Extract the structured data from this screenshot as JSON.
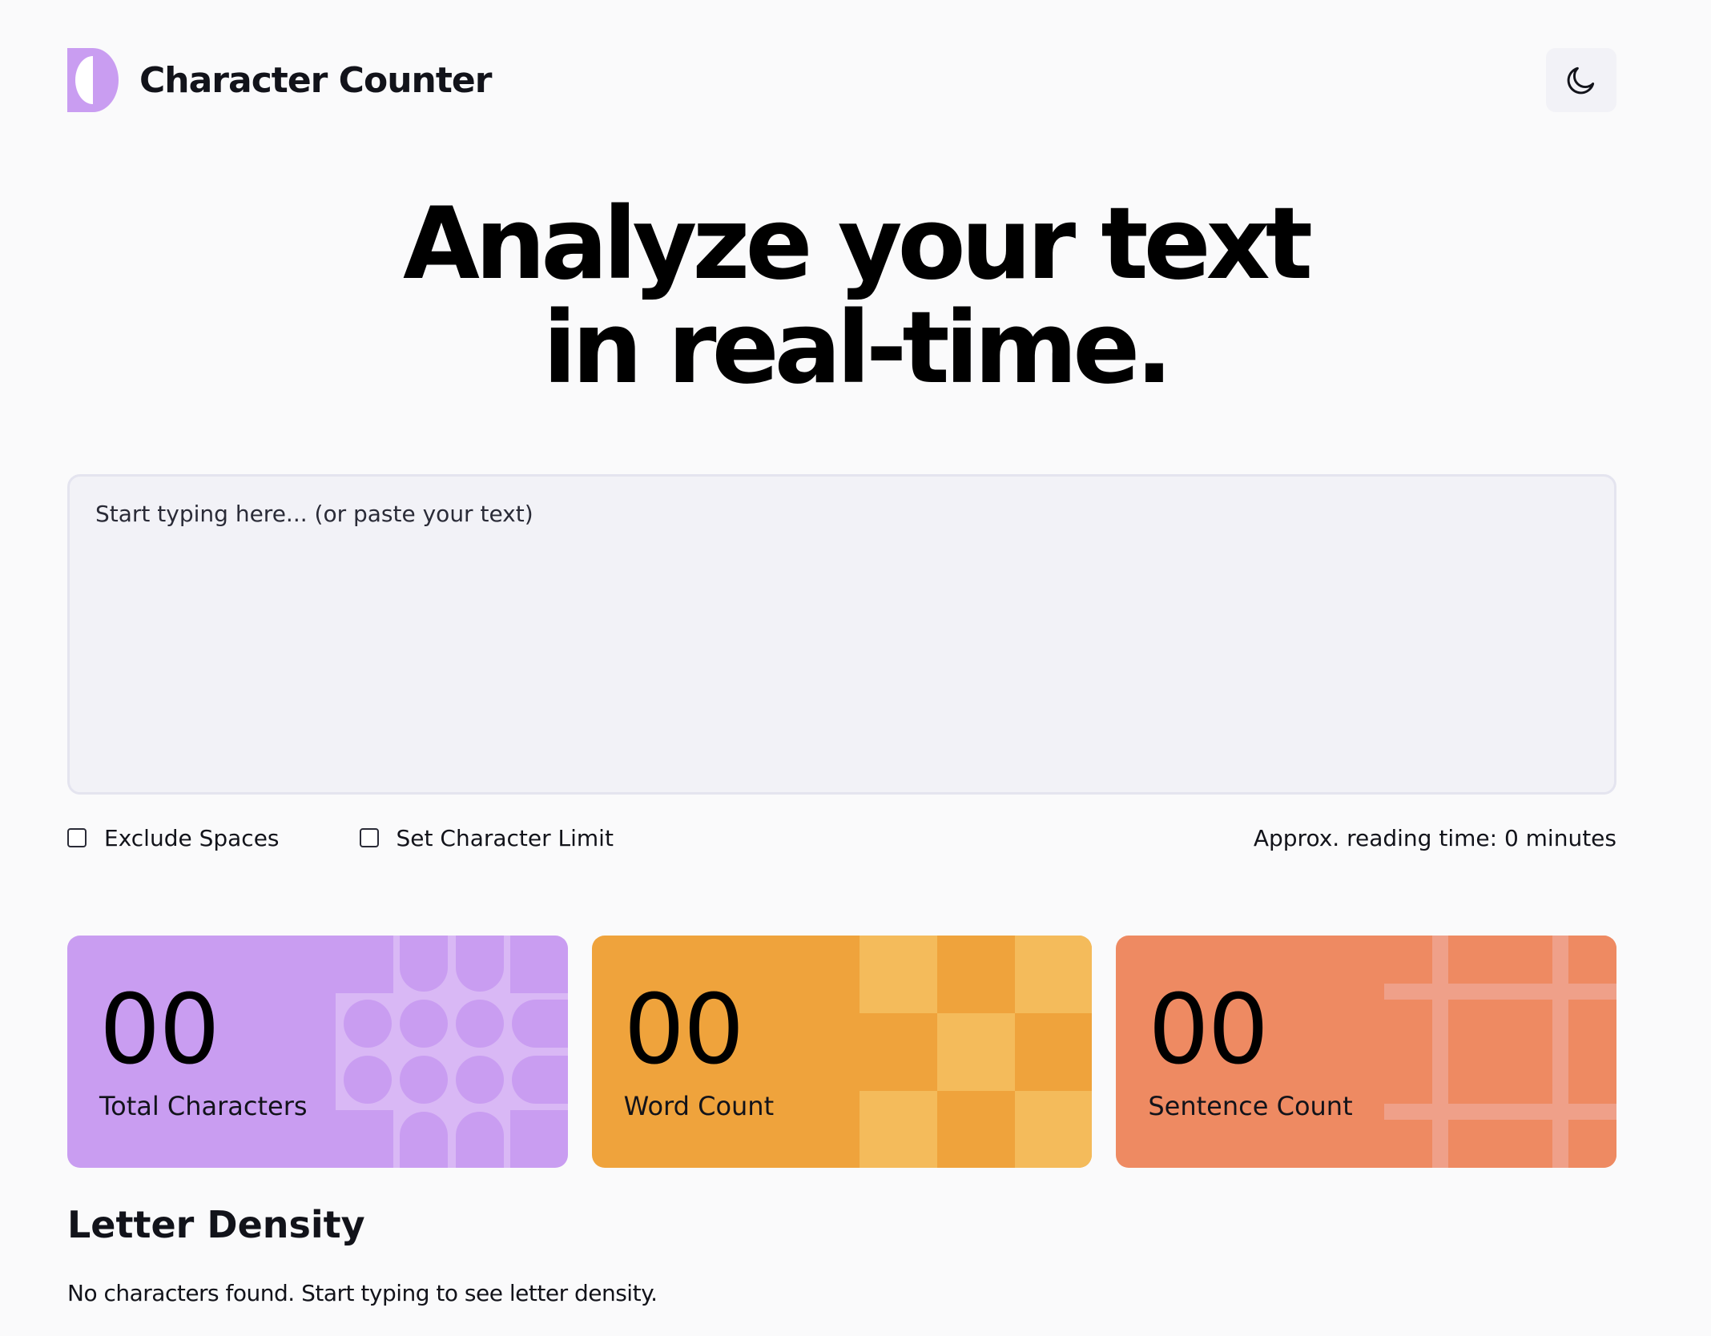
{
  "header": {
    "title": "Character Counter",
    "logo_icon": "character-counter-logo",
    "theme_toggle_icon": "moon-icon"
  },
  "hero": {
    "line1": "Analyze your text",
    "line2": "in real-time."
  },
  "editor": {
    "placeholder": "Start typing here... (or paste your text)",
    "value": ""
  },
  "options": {
    "exclude_spaces_label": "Exclude Spaces",
    "exclude_spaces_checked": false,
    "char_limit_label": "Set Character Limit",
    "char_limit_checked": false,
    "reading_time": "Approx. reading time: 0 minutes"
  },
  "stats": [
    {
      "value": "00",
      "label": "Total Characters",
      "color": "#c99df1"
    },
    {
      "value": "00",
      "label": "Word Count",
      "color": "#efa33c"
    },
    {
      "value": "00",
      "label": "Sentence Count",
      "color": "#ee8a62"
    }
  ],
  "density": {
    "title": "Letter Density",
    "empty_message": "No characters found. Start typing to see letter density."
  }
}
